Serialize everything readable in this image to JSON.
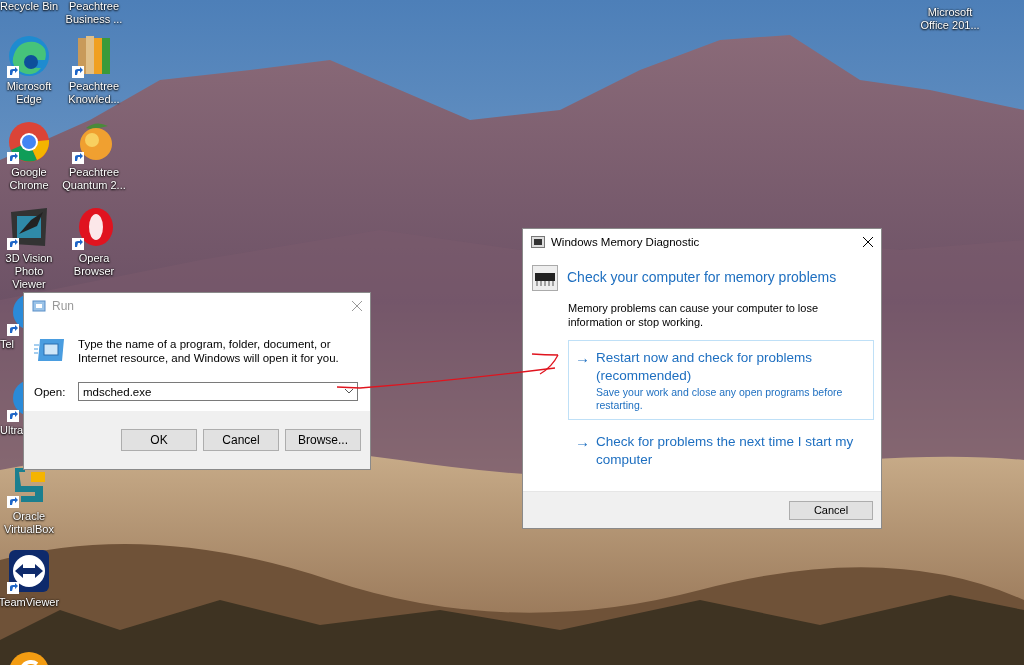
{
  "desktop": {
    "left_column": [
      {
        "label": "Recycle Bin",
        "partly_hidden": false
      },
      {
        "label": "Microsoft Edge",
        "kind": "swirl",
        "partly_hidden": false
      },
      {
        "label": "Google Chrome",
        "kind": "ring-logo",
        "partly_hidden": false
      },
      {
        "label": "3D Vision Photo Viewer",
        "kind": "picture",
        "partly_hidden": false
      },
      {
        "label": "Tel",
        "kind": "app",
        "partly_hidden": true
      },
      {
        "label": "Ultra",
        "kind": "app",
        "partly_hidden": true
      },
      {
        "label": "Oracle VirtualBox",
        "kind": "cube",
        "partly_hidden": false
      },
      {
        "label": "TeamViewer",
        "kind": "double-arrow",
        "partly_hidden": false
      },
      {
        "kind": "c-logo"
      }
    ],
    "second_column": [
      {
        "label": "Peachtree Business ...",
        "partly_hidden": false
      },
      {
        "label": "Peachtree Knowled...",
        "kind": "binders",
        "partly_hidden": false
      },
      {
        "label": "Peachtree Quantum 2...",
        "kind": "peach",
        "partly_hidden": false
      },
      {
        "label": "Opera Browser",
        "kind": "o-ring",
        "partly_hidden": false
      }
    ],
    "right_column": [
      {
        "label": "Microsoft Office 201...",
        "partly_hidden": false
      }
    ]
  },
  "run_dialog": {
    "title": "Run",
    "description": "Type the name of a program, folder, document, or Internet resource, and Windows will open it for you.",
    "open_label": "Open:",
    "open_value": "mdsched.exe",
    "buttons": [
      "OK",
      "Cancel",
      "Browse..."
    ]
  },
  "memory_dialog": {
    "title": "Windows Memory Diagnostic",
    "heading": "Check your computer for memory problems",
    "description": "Memory problems can cause your computer to lose information or stop working.",
    "options": [
      {
        "arrow": "→",
        "title": "Restart now and check for problems (recommended)",
        "subtitle": "Save your work and close any open programs before restarting.",
        "selected": true
      },
      {
        "arrow": "→",
        "title": "Check for problems the next time I start my computer",
        "selected": false
      }
    ],
    "buttons": [
      "Cancel"
    ]
  }
}
